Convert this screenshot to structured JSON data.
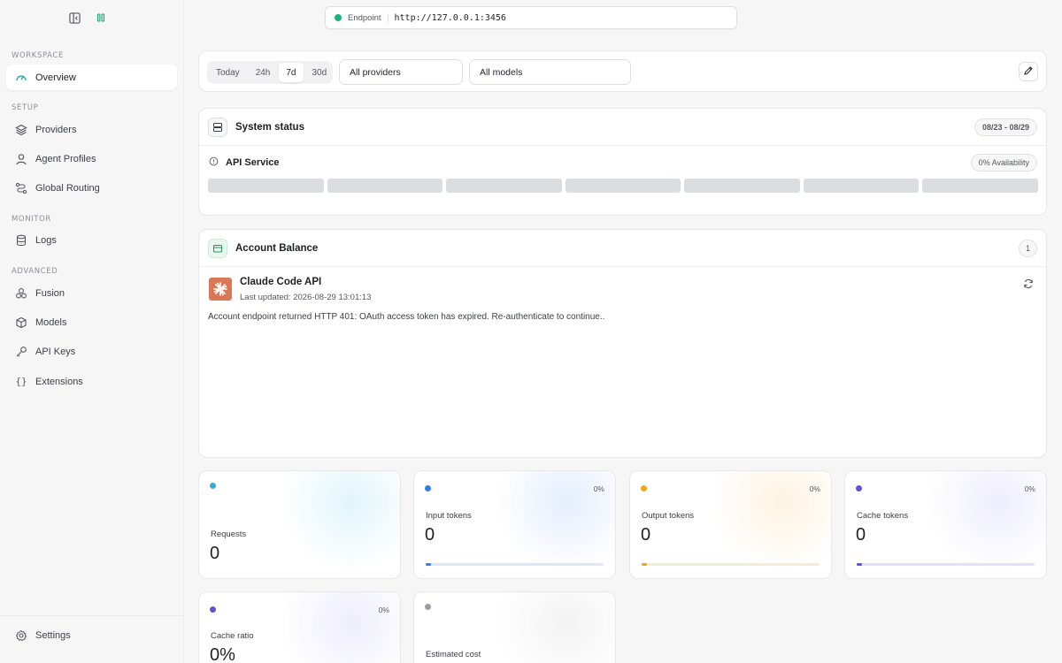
{
  "sidebar": {
    "sections": [
      "WORKSPACE",
      "SETUP",
      "MONITOR",
      "ADVANCED"
    ],
    "items": [
      {
        "label": "Overview"
      },
      {
        "label": "Providers"
      },
      {
        "label": "Agent Profiles"
      },
      {
        "label": "Global Routing"
      },
      {
        "label": "Logs"
      },
      {
        "label": "Fusion"
      },
      {
        "label": "Models"
      },
      {
        "label": "API Keys"
      },
      {
        "label": "Extensions"
      }
    ],
    "settings_label": "Settings"
  },
  "endpoint": {
    "label": "Endpoint",
    "url": "http://127.0.0.1:3456",
    "status_color": "#16b47a"
  },
  "filters": {
    "ranges": [
      "Today",
      "24h",
      "7d",
      "30d"
    ],
    "active_range": "7d",
    "provider": "All providers",
    "model": "All models"
  },
  "system_status": {
    "title": "System status",
    "date_range": "08/23 - 08/29",
    "service": "API Service",
    "availability": "0% Availability"
  },
  "balance": {
    "title": "Account Balance",
    "count": "1",
    "name": "Claude Code API",
    "updated": "Last updated: 2026-08-29 13:01:13",
    "message": "Account endpoint returned HTTP 401: OAuth access token has expired. Re-authenticate to continue.."
  },
  "stats": {
    "requests": {
      "label": "Requests",
      "value": "0",
      "color": "#38a8e0"
    },
    "input": {
      "label": "Input tokens",
      "value": "0",
      "pct": "0%",
      "color": "#2f7fe6",
      "progress": 0
    },
    "output": {
      "label": "Output tokens",
      "value": "0",
      "pct": "0%",
      "color": "#f2a516",
      "progress": 0
    },
    "cache": {
      "label": "Cache tokens",
      "value": "0",
      "pct": "0%",
      "color": "#5b52d9",
      "progress": 0
    },
    "ratio": {
      "label": "Cache ratio",
      "value": "0%",
      "pct": "0%",
      "color": "#5b52d9"
    },
    "cost": {
      "label": "Estimated cost",
      "color": "#9a9ca2"
    }
  },
  "icons": [
    "sidebar-toggle-icon",
    "pause-icon",
    "gauge-icon",
    "layers-icon",
    "user-icon",
    "routing-icon",
    "database-icon",
    "fusion-icon",
    "cube-icon",
    "key-icon",
    "braces-icon",
    "gear-icon",
    "pencil-icon",
    "server-icon",
    "info-icon",
    "wallet-icon",
    "refresh-icon"
  ]
}
